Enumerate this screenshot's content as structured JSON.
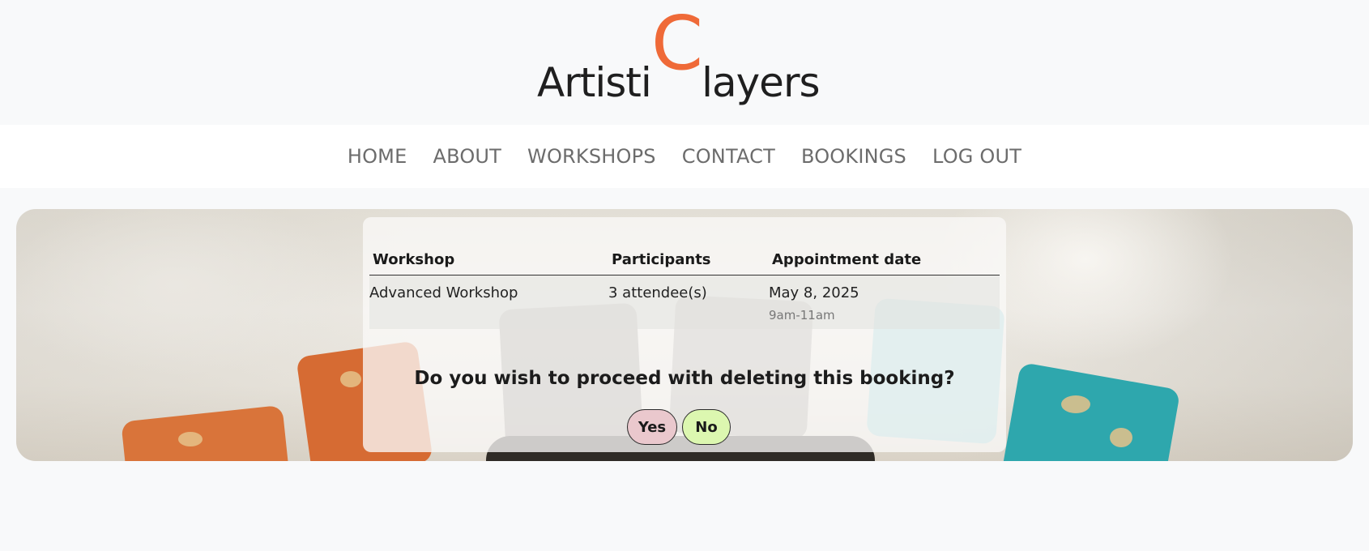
{
  "logo": {
    "part1": "Artisti",
    "big_letter": "C",
    "part2": "layers"
  },
  "nav": {
    "items": [
      "HOME",
      "ABOUT",
      "WORKSHOPS",
      "CONTACT",
      "BOOKINGS",
      "LOG OUT"
    ]
  },
  "booking": {
    "headers": {
      "workshop": "Workshop",
      "participants": "Participants",
      "date": "Appointment date"
    },
    "row": {
      "workshop": "Advanced Workshop",
      "participants": "3 attendee(s)",
      "date": "May 8, 2025",
      "time": "9am-11am"
    }
  },
  "confirm": {
    "question": "Do you wish to proceed with deleting this booking?",
    "yes_label": "Yes",
    "no_label": "No"
  },
  "colors": {
    "accent": "#ef6a38",
    "yes_bg": "#eac8cd",
    "no_bg": "#dcf7b0"
  }
}
